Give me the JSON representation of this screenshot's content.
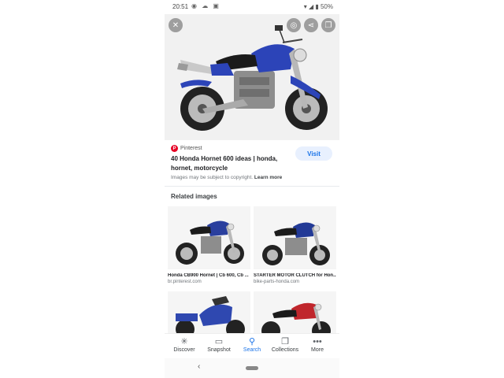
{
  "status_bar": {
    "time": "20:51",
    "battery": "50%"
  },
  "result": {
    "source": "Pinterest",
    "title": "40 Honda Hornet 600 ideas | honda, hornet, motorcycle",
    "visit_label": "Visit",
    "copyright_text": "Images may be subject to copyright.",
    "learn_more": "Learn more"
  },
  "related": {
    "heading": "Related images",
    "items": [
      {
        "caption": "Honda CB900 Hornet | Cb 600, Cb ...",
        "domain": "br.pinterest.com",
        "color": "#2a3f9e"
      },
      {
        "caption": "STARTER MOTOR CLUTCH for Hon...",
        "domain": "bike-parts-honda.com",
        "color": "#233a96"
      },
      {
        "caption": "",
        "domain": "",
        "color": "#2f48b0"
      },
      {
        "caption": "",
        "domain": "",
        "color": "#c0262c"
      }
    ]
  },
  "bottom_nav": [
    {
      "label": "Discover",
      "icon": "asterisk-icon"
    },
    {
      "label": "Snapshot",
      "icon": "snapshot-icon"
    },
    {
      "label": "Search",
      "icon": "search-icon",
      "active": true
    },
    {
      "label": "Collections",
      "icon": "collections-icon"
    },
    {
      "label": "More",
      "icon": "more-dots-icon"
    }
  ],
  "colors": {
    "accent": "#1a73e8",
    "pinterest": "#e60023",
    "bike_blue": "#2c44b8"
  }
}
